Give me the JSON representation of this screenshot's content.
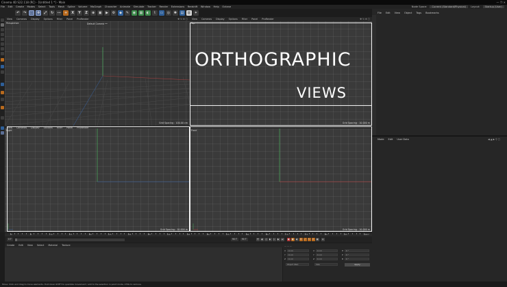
{
  "window": {
    "title": "Cinema 4D S22.118 (RC) - [Untitled 1 *] - Main",
    "controls": "—  ❐  ✕"
  },
  "menu": [
    "File",
    "Edit",
    "Create",
    "Modes",
    "Select",
    "Tools",
    "Mesh",
    "Spline",
    "Volume",
    "MoGraph",
    "Character",
    "Animate",
    "Simulate",
    "Tracker",
    "Render",
    "Extensions",
    "Redshift",
    "Window",
    "Help",
    "Octane"
  ],
  "menu_right": {
    "node_space_label": "Node Space:",
    "node_space_value": "Current (Standard/Physical)",
    "layout_label": "Layout:",
    "layout_value": "Startup (User)"
  },
  "toolbar_icons": [
    "undo-icon",
    "redo-icon",
    "select-icon",
    "move-icon",
    "scale-icon",
    "rotate-icon",
    "recent-icon",
    "x-axis-icon",
    "y-axis-icon",
    "z-axis-icon",
    "coord-icon",
    "render-region-icon",
    "render-view-icon",
    "render-settings-icon",
    "cube-icon",
    "pen-icon",
    "subdivision-icon",
    "array-icon",
    "boole-icon",
    "deformer-icon",
    "floor-icon",
    "camera-icon",
    "light-icon",
    "tag-icon",
    "texture-icon",
    "octane-icon",
    "octane-live-icon"
  ],
  "toolbar_text": {
    "x": "X",
    "y": "Y",
    "z": "Z"
  },
  "viewport_menu": [
    "View",
    "Cameras",
    "Display",
    "Options",
    "Filter",
    "Panel",
    "ProRender"
  ],
  "viewports": {
    "perspective": {
      "label": "Perspective",
      "camera": "Default Camera ••",
      "grid": "Grid Spacing : 100.00 cm"
    },
    "top": {
      "label": "Top",
      "grid": "Grid Spacing : 10.000 m"
    },
    "right": {
      "label": "Right",
      "grid": "Grid Spacing : 10.000 m"
    },
    "front": {
      "label": "Front",
      "grid": "Grid Spacing : 10.000 m"
    }
  },
  "overlay": {
    "title": "ORTHOGRAPHIC",
    "subtitle": "VIEWS"
  },
  "object_manager_menu": [
    "File",
    "Edit",
    "View",
    "Object",
    "Tags",
    "Bookmarks"
  ],
  "attributes_menu": [
    "Mode",
    "Edit",
    "User Data"
  ],
  "timeline": {
    "labels": [
      "0",
      "5",
      "10",
      "15",
      "20",
      "25",
      "30",
      "35",
      "40",
      "45",
      "50",
      "55",
      "60",
      "65",
      "70",
      "75",
      "80",
      "85",
      "90"
    ],
    "end": "0 F"
  },
  "transport": {
    "start": "0 F",
    "current": "0 F",
    "end": "90 F",
    "end2": "90 F"
  },
  "material_menu": [
    "Create",
    "Edit",
    "View",
    "Select",
    "Material",
    "Texture"
  ],
  "coords": {
    "rows": [
      {
        "axis": "X",
        "pos": "0 cm",
        "rot_axis": "X",
        "rot": "0 cm",
        "h_axis": "H",
        "h": "0 °"
      },
      {
        "axis": "Y",
        "pos": "0 cm",
        "rot_axis": "Y",
        "rot": "0 cm",
        "h_axis": "P",
        "h": "0 °"
      },
      {
        "axis": "Z",
        "pos": "0 cm",
        "rot_axis": "Z",
        "rot": "0 cm",
        "h_axis": "B",
        "h": "0 °"
      }
    ],
    "mode1": "Object (Rel)",
    "mode2": "Size",
    "apply": "Apply"
  },
  "status": "Move: Click and drag to move elements. Hold down SHIFT to quantize movement / add to the selection in point mode, CTRL to remove."
}
